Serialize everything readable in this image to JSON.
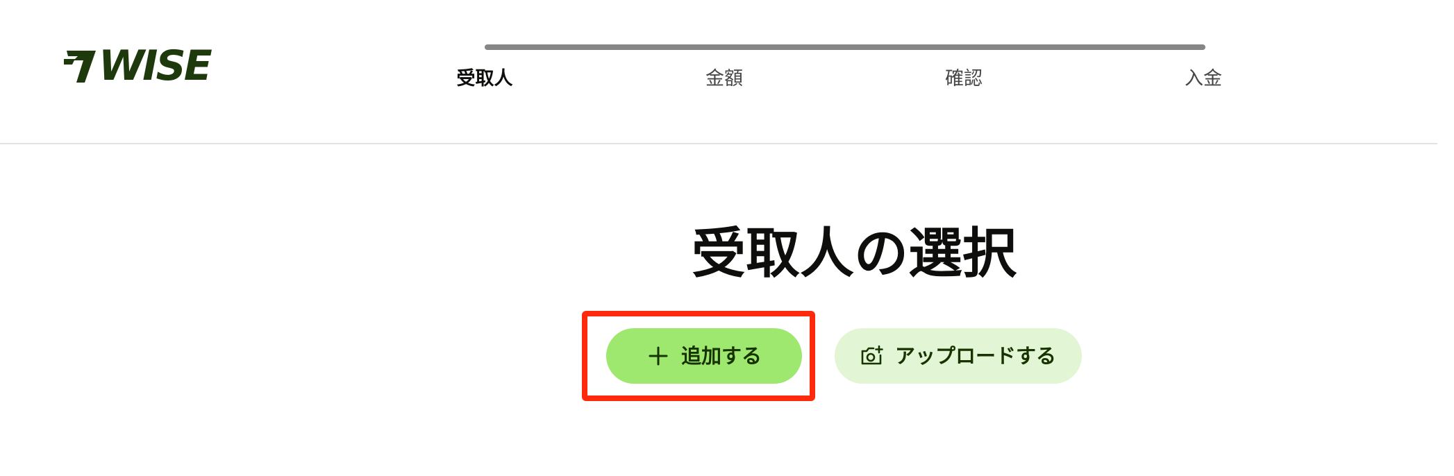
{
  "header": {
    "logo_text": "WISE",
    "progress": {
      "steps": [
        "受取人",
        "金額",
        "確認",
        "入金"
      ],
      "active_step": 0
    }
  },
  "main": {
    "title": "受取人の選択",
    "add_button_label": "追加する",
    "upload_button_label": "アップロードする"
  },
  "icons": {
    "logo": "wise-flag-logo",
    "add": "plus-icon",
    "upload": "camera-plus-icon"
  },
  "colors": {
    "brand_dark": "#163300",
    "primary_button": "#9fe870",
    "secondary_button": "#e2f6d5",
    "highlight_annotation": "#ff2a0c",
    "progress_track": "#868686"
  }
}
